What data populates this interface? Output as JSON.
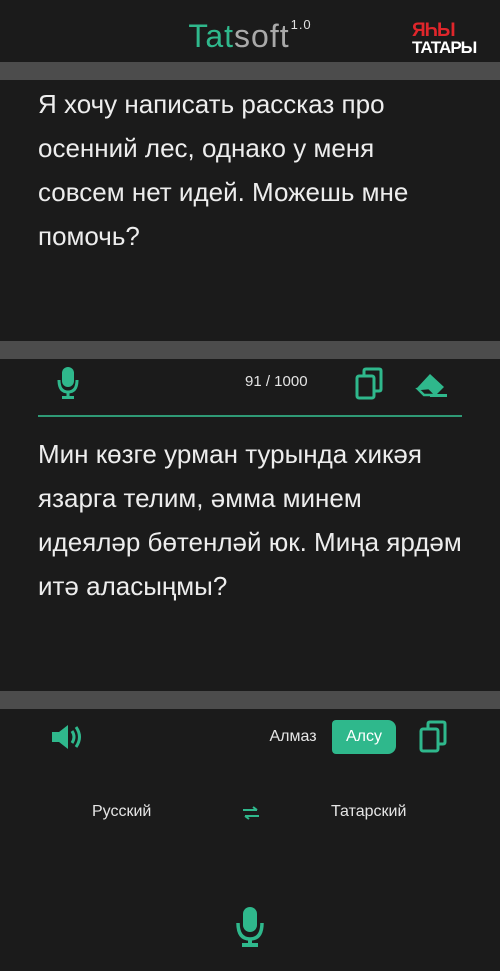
{
  "header": {
    "logo_part1": "Tat",
    "logo_part2": "soft",
    "logo_version": "1.0",
    "brand_line1": "ЯҺЫ",
    "brand_line2": "ТАТАРЫ"
  },
  "source": {
    "text": "Я хочу написать рассказ про осенний лес, однако у меня совсем нет идей.  Можешь мне помочь?",
    "counter": "91 / 1000"
  },
  "target": {
    "text": "Мин көзге урман турында хикәя язарга телим, әмма минем идеяләр бөтенләй юк. Миңа ярдәм итә аласыңмы?"
  },
  "voices": {
    "option1": "Алмаз",
    "option2": "Алсу",
    "selected": "Алсу"
  },
  "languages": {
    "from": "Русский",
    "to": "Татарский"
  },
  "colors": {
    "accent": "#2fb88c",
    "background": "#1b1b1b",
    "band": "#4c4c4c",
    "brand_red": "#e0262b"
  },
  "icons": {
    "mic_input": "microphone-icon",
    "copy_source": "copy-icon",
    "clear": "eraser-icon",
    "speaker": "speaker-icon",
    "copy_target": "copy-icon",
    "swap": "swap-arrows-icon",
    "mic_main": "microphone-icon"
  }
}
